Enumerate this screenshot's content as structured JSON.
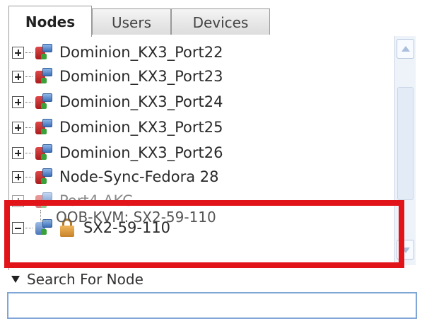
{
  "tabs": [
    {
      "label": "Nodes",
      "active": true
    },
    {
      "label": "Users",
      "active": false
    },
    {
      "label": "Devices",
      "active": false
    }
  ],
  "tree": {
    "nodes": [
      {
        "label": "Dominion_KX3_Port22",
        "expander": "plus",
        "icon": "node-icon"
      },
      {
        "label": "Dominion_KX3_Port23",
        "expander": "plus",
        "icon": "node-icon"
      },
      {
        "label": "Dominion_KX3_Port24",
        "expander": "plus",
        "icon": "node-icon"
      },
      {
        "label": "Dominion_KX3_Port25",
        "expander": "plus",
        "icon": "node-icon"
      },
      {
        "label": "Dominion_KX3_Port26",
        "expander": "plus",
        "icon": "node-icon"
      },
      {
        "label": "Node-Sync-Fedora 28",
        "expander": "plus",
        "icon": "node-icon"
      },
      {
        "label": "Port4-AKC",
        "expander": "plus",
        "icon": "node-icon"
      },
      {
        "label": "SX2-59-110",
        "expander": "minus",
        "icon": "locked-node-icon"
      }
    ],
    "child": {
      "label": "OOB-KVM: SX2-59-110"
    }
  },
  "search": {
    "header_label": "Search For Node",
    "value": "",
    "placeholder": ""
  },
  "colors": {
    "highlight": "#e1141a",
    "tab_border": "#9a9a9a",
    "input_border": "#7fa6d6"
  }
}
